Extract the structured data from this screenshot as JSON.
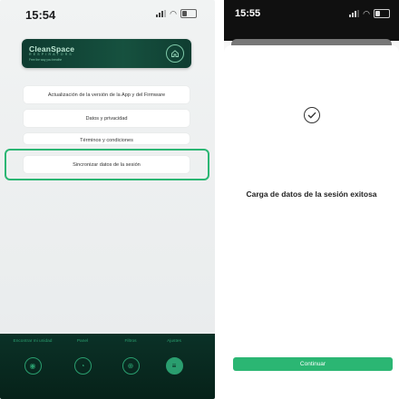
{
  "left": {
    "status_time": "15:54",
    "brand": {
      "name": "CleanSpace",
      "sub": "RESPIRATORS",
      "tagline": "Free the way you breathe"
    },
    "menu": [
      "Actualización de la versión de la App y del Firmware",
      "Datos y privacidad",
      "Términos y condiciones",
      "Sincronizar datos de la sesión"
    ],
    "tabs": [
      {
        "label": "Encontrar mi unidad",
        "icon": "location-pin-icon"
      },
      {
        "label": "Panel",
        "icon": "dashboard-gauge-icon"
      },
      {
        "label": "Filtros",
        "icon": "filter-icon"
      },
      {
        "label": "Ajustes",
        "icon": "settings-sliders-icon",
        "active": true
      }
    ],
    "colors": {
      "accent": "#2bb673",
      "header": "#16513f",
      "tabbar": "#062219"
    }
  },
  "right": {
    "status_time": "15:55",
    "message": "Carga de datos de la sesión exitosa",
    "continue_label": "Continuar",
    "colors": {
      "button": "#2bb673"
    }
  }
}
